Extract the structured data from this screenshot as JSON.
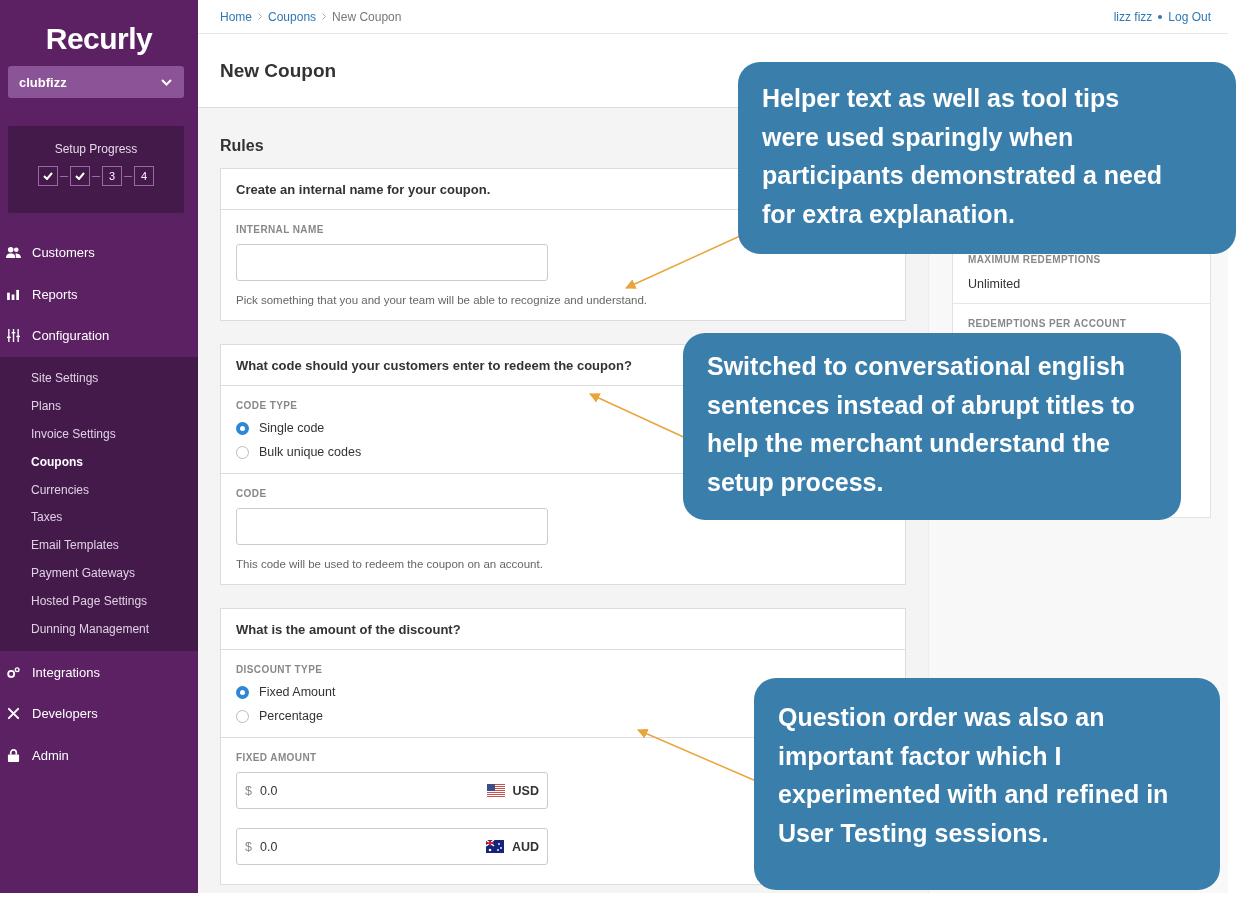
{
  "sidebar": {
    "logo": "Recurly",
    "account": "clubfizz",
    "setup": {
      "title": "Setup Progress",
      "steps": [
        {
          "done": true
        },
        {
          "done": true
        },
        {
          "label": "3",
          "done": false
        },
        {
          "label": "4",
          "done": false
        }
      ]
    },
    "nav": [
      {
        "label": "Customers"
      },
      {
        "label": "Reports"
      },
      {
        "label": "Configuration",
        "children": [
          {
            "label": "Site Settings",
            "selected": false
          },
          {
            "label": "Plans",
            "selected": false
          },
          {
            "label": "Invoice Settings",
            "selected": false
          },
          {
            "label": "Coupons",
            "selected": true
          },
          {
            "label": "Currencies",
            "selected": false
          },
          {
            "label": "Taxes",
            "selected": false
          },
          {
            "label": "Email Templates",
            "selected": false
          },
          {
            "label": "Payment Gateways",
            "selected": false
          },
          {
            "label": "Hosted Page Settings",
            "selected": false
          },
          {
            "label": "Dunning Management",
            "selected": false
          }
        ]
      },
      {
        "label": "Integrations"
      },
      {
        "label": "Developers"
      },
      {
        "label": "Admin"
      }
    ]
  },
  "header": {
    "breadcrumbs": [
      {
        "label": "Home",
        "link": true
      },
      {
        "label": "Coupons",
        "link": true
      },
      {
        "label": "New Coupon",
        "link": false
      }
    ],
    "user": "lizz fizz",
    "logout": "Log Out"
  },
  "page_title": "New Coupon",
  "form": {
    "title": "Rules",
    "cards": [
      {
        "heading": "Create an internal name for your coupon.",
        "sections": [
          {
            "kind": "text",
            "label": "INTERNAL NAME",
            "help": "Pick something that you and your team will be able to recognize and understand."
          }
        ]
      },
      {
        "heading": "What code should your customers enter to redeem the coupon?",
        "sections": [
          {
            "kind": "radio",
            "label": "CODE TYPE",
            "options": [
              {
                "label": "Single code",
                "selected": true
              },
              {
                "label": "Bulk unique codes",
                "selected": false
              }
            ]
          },
          {
            "kind": "text",
            "label": "CODE",
            "help": "This code will be used to redeem the coupon on an account."
          }
        ]
      },
      {
        "heading": "What is the amount of the discount?",
        "sections": [
          {
            "kind": "radio",
            "label": "DISCOUNT TYPE",
            "options": [
              {
                "label": "Fixed Amount",
                "selected": true
              },
              {
                "label": "Percentage",
                "selected": false
              }
            ]
          },
          {
            "kind": "money",
            "label": "FIXED AMOUNT",
            "amounts": [
              {
                "symbol": "$",
                "value": "0.0",
                "currency": "USD"
              },
              {
                "symbol": "$",
                "value": "0.0",
                "currency": "AUD"
              }
            ]
          }
        ]
      }
    ]
  },
  "summary": [
    {
      "label": "MAXIMUM REDEMPTIONS",
      "value": "Unlimited"
    },
    {
      "label": "REDEMPTIONS PER ACCOUNT"
    }
  ],
  "callouts": [
    {
      "text": "Helper text as well as tool tips were used sparingly when participants demonstrated a need for extra explanation."
    },
    {
      "text": "Switched to conversational english sentences instead of abrupt titles to help the merchant understand the setup process."
    },
    {
      "text": "Question order was also an important factor which I experimented with and refined in User Testing sessions."
    }
  ]
}
